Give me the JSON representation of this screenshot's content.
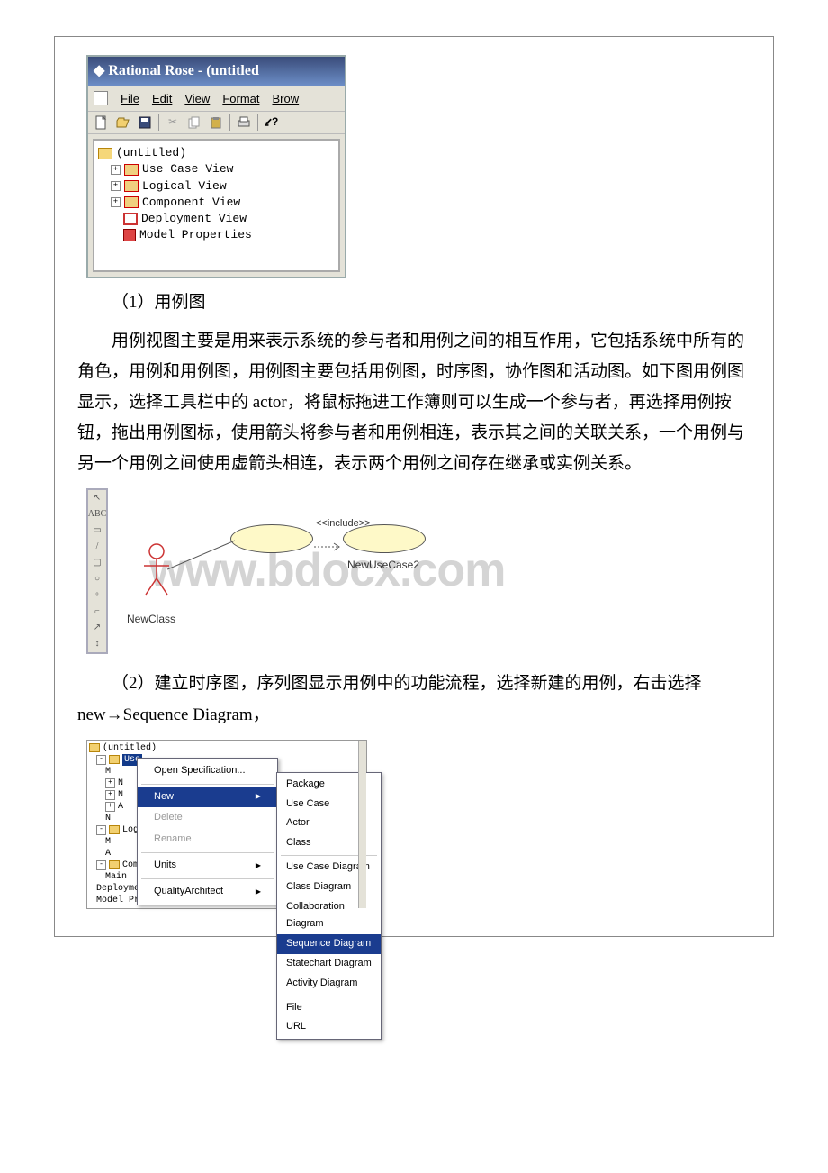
{
  "fig1": {
    "title": "Rational Rose - (untitled",
    "menubar": [
      "File",
      "Edit",
      "View",
      "Format",
      "Brow"
    ],
    "tree": {
      "root": "(untitled)",
      "items": [
        "Use Case View",
        "Logical View",
        "Component View",
        "Deployment View",
        "Model Properties"
      ]
    }
  },
  "section1": {
    "heading": "（1）用例图",
    "body": "用例视图主要是用来表示系统的参与者和用例之间的相互作用，它包括系统中所有的角色，用例和用例图，用例图主要包括用例图，时序图，协作图和活动图。如下图用例图显示，选择工具栏中的 actor，将鼠标拖进工作簿则可以生成一个参与者，再选择用例按钮，拖出用例图标，使用箭头将参与者和用例相连，表示其之间的关联关系，一个用例与另一个用例之间使用虚箭头相连，表示两个用例之间存在继承或实例关系。"
  },
  "fig2": {
    "toolbox": [
      "↖",
      "ABC",
      "▭",
      "/",
      "▢",
      "○",
      "ᵒ",
      "⌐",
      "↗",
      "↕"
    ],
    "include_label": "<<include>>",
    "actor_label": "NewClass",
    "usecase2_label": "NewUseCase2",
    "watermark": "www.bdocx.com"
  },
  "section2": {
    "body": "（2）建立时序图，序列图显示用例中的功能流程，选择新建的用例，右击选择 new→Sequence Diagram，"
  },
  "fig3": {
    "root": "(untitled)",
    "tree_items": [
      "Use",
      "M",
      "N",
      "N",
      "A",
      "N",
      "Logi",
      "M",
      "A",
      "Component View",
      "Main",
      "Deployment View",
      "Model Properties"
    ],
    "context_menu": [
      {
        "label": "Open Specification...",
        "type": "normal"
      },
      {
        "type": "sep"
      },
      {
        "label": "New",
        "type": "hl",
        "arrow": true
      },
      {
        "label": "Delete",
        "type": "dis"
      },
      {
        "label": "Rename",
        "type": "dis"
      },
      {
        "type": "sep"
      },
      {
        "label": "Units",
        "type": "normal",
        "arrow": true
      },
      {
        "type": "sep"
      },
      {
        "label": "QualityArchitect",
        "type": "normal",
        "arrow": true
      }
    ],
    "submenu": [
      "Package",
      "Use Case",
      "Actor",
      "Class",
      "__sep__",
      "Use Case Diagram",
      "Class Diagram",
      "Collaboration Diagram",
      "Sequence Diagram",
      "Statechart Diagram",
      "Activity Diagram",
      "__sep__",
      "File",
      "URL"
    ],
    "submenu_highlight": "Sequence Diagram"
  }
}
